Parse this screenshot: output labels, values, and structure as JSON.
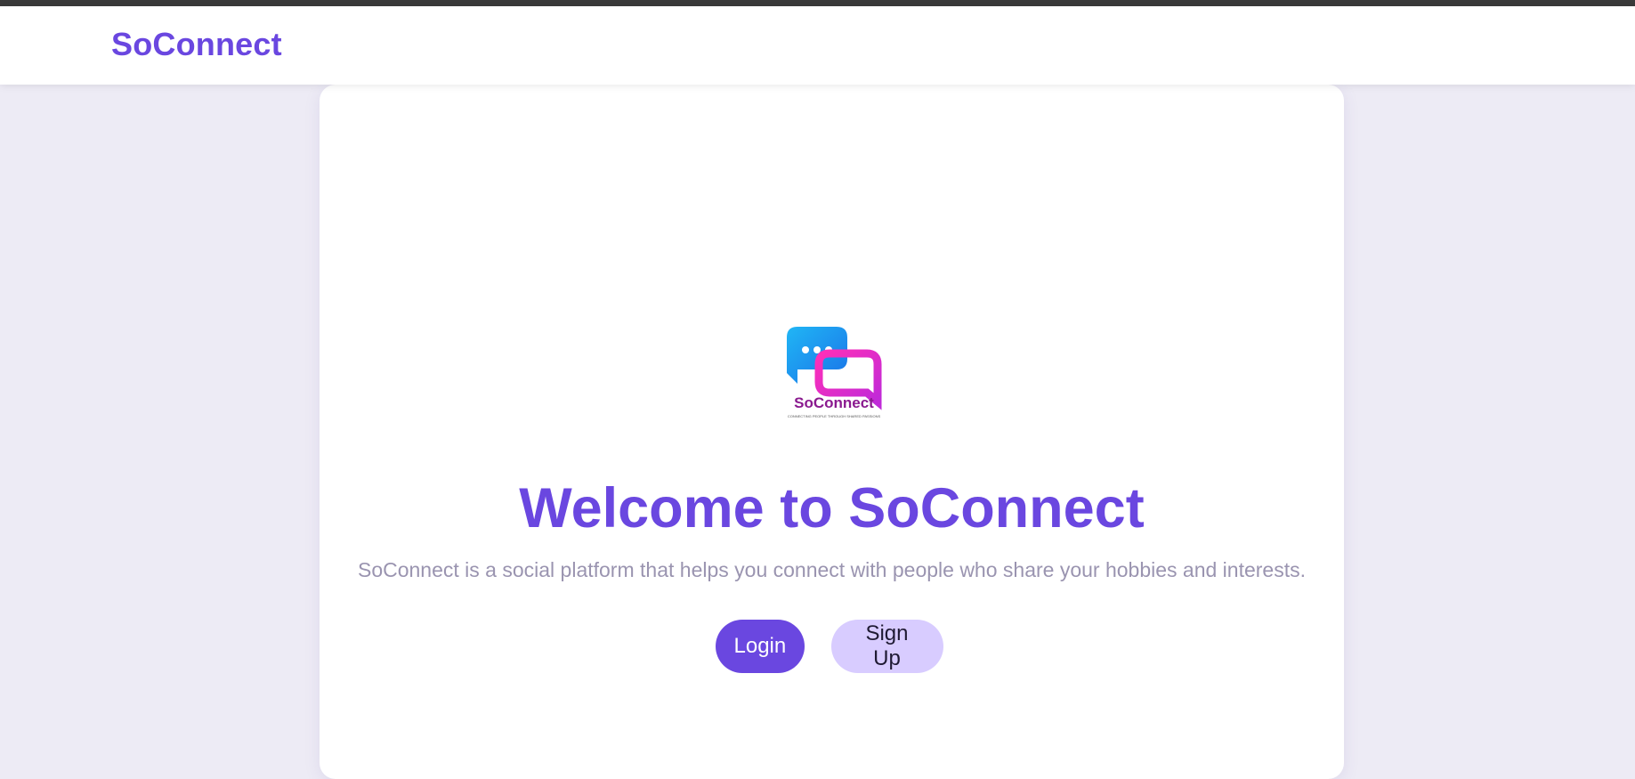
{
  "navbar": {
    "brand": "SoConnect"
  },
  "hero": {
    "logo_icon": "soconnect-logo-icon",
    "logo_wordmark": "SoConnect",
    "logo_tagline": "CONNECTING PEOPLE THROUGH SHARED PASSIONS",
    "title": "Welcome to SoConnect",
    "subtitle": "SoConnect is a social platform that helps you connect with people who share your hobbies and interests.",
    "login_label": "Login",
    "signup_label": "Sign Up"
  },
  "colors": {
    "accent": "#6a47e0",
    "accent_light": "#d8ccff",
    "page_bg": "#edebf5",
    "muted_text": "#9a94b0",
    "logo_blue": "#1aa3f0",
    "logo_pink": "#e61fc8"
  }
}
